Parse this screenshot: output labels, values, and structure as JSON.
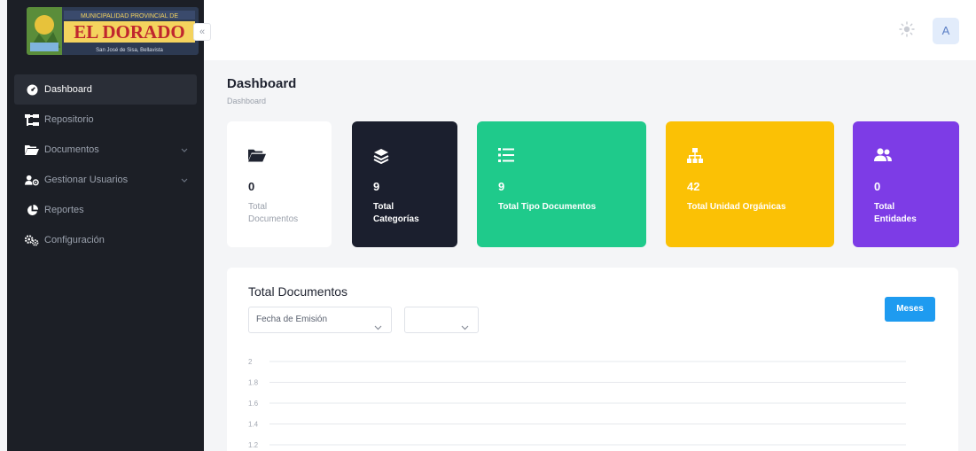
{
  "sidebar": {
    "logo": {
      "line1": "MUNICIPALIDAD PROVINCIAL DE",
      "line2": "EL DORADO",
      "line3": "San José de Sisa, Bellavista"
    },
    "collapse_icon": "chevron-double-left-icon",
    "items": [
      {
        "label": "Dashboard",
        "icon": "dashboard-icon",
        "active": true
      },
      {
        "label": "Repositorio",
        "icon": "sitemap-icon"
      },
      {
        "label": "Documentos",
        "icon": "folder-open-icon",
        "has_submenu": true
      },
      {
        "label": "Gestionar Usuarios",
        "icon": "users-cog-icon",
        "has_submenu": true
      },
      {
        "label": "Reportes",
        "icon": "pie-chart-icon"
      },
      {
        "label": "Configuración",
        "icon": "cogs-icon"
      }
    ]
  },
  "header": {
    "theme_icon": "sun-icon",
    "avatar_initial": "A"
  },
  "page": {
    "title": "Dashboard",
    "breadcrumb": "Dashboard"
  },
  "cards": [
    {
      "value": "0",
      "label_line1": "Total",
      "label_line2": "Documentos",
      "icon": "folder-open-icon",
      "bg": "#ffffff",
      "fg": "#1f2330",
      "label_color": "#9aa0ab"
    },
    {
      "value": "9",
      "label_line1": "Total",
      "label_line2": "Categorías",
      "icon": "layers-icon",
      "bg": "#1b1f2e",
      "fg": "#ffffff",
      "label_color": "#ffffff"
    },
    {
      "value": "9",
      "label_line1": "Total Tipo Documentos",
      "label_line2": "",
      "icon": "list-icon",
      "bg": "#1fca8b",
      "fg": "#ffffff",
      "label_color": "#ffffff"
    },
    {
      "value": "42",
      "label_line1": "Total Unidad Orgánicas",
      "label_line2": "",
      "icon": "sitemap-icon",
      "bg": "#fbc105",
      "fg": "#ffffff",
      "label_color": "#ffffff"
    },
    {
      "value": "0",
      "label_line1": "Total",
      "label_line2": "Entidades",
      "icon": "users-icon",
      "bg": "#7d3ce6",
      "fg": "#ffffff",
      "label_color": "#ffffff"
    }
  ],
  "documents_panel": {
    "title": "Total Documentos",
    "filter_date": {
      "value": "Fecha de Emisión"
    },
    "filter_period": {
      "value": ""
    },
    "meses_button": "Meses"
  },
  "chart_data": {
    "type": "line",
    "title": "",
    "xlabel": "",
    "ylabel": "",
    "y_ticks": [
      "2",
      "1.8",
      "1.6",
      "1.4",
      "1.2"
    ],
    "ylim": [
      1.2,
      2
    ],
    "grid": true,
    "series": []
  },
  "colors": {
    "sidebar_bg": "#1c1f26",
    "accent_blue": "#1e9bf0",
    "green": "#1fca8b",
    "yellow": "#fbc105",
    "purple": "#7d3ce6",
    "dark": "#1b1f2e"
  }
}
